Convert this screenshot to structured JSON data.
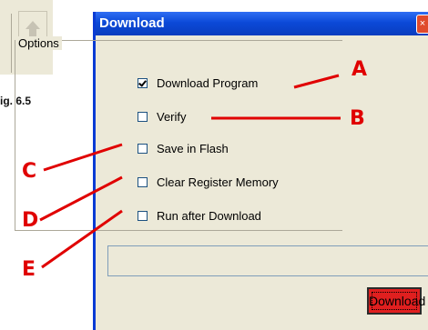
{
  "figure": {
    "label": "ig. 6.5"
  },
  "window": {
    "title": "Download",
    "close_glyph": "×"
  },
  "options": {
    "group_label": "Options",
    "items": [
      {
        "label": "Download Program",
        "checked": true
      },
      {
        "label": "Verify",
        "checked": false
      },
      {
        "label": "Save in Flash",
        "checked": false
      },
      {
        "label": "Clear Register Memory",
        "checked": false
      },
      {
        "label": "Run after Download",
        "checked": false
      }
    ]
  },
  "status_field": {
    "value": ""
  },
  "download_button": {
    "label": "Download",
    "color": "#e01f1f"
  },
  "annotations": {
    "color": "#e00000",
    "labels": [
      "A",
      "B",
      "C",
      "D",
      "E"
    ]
  }
}
